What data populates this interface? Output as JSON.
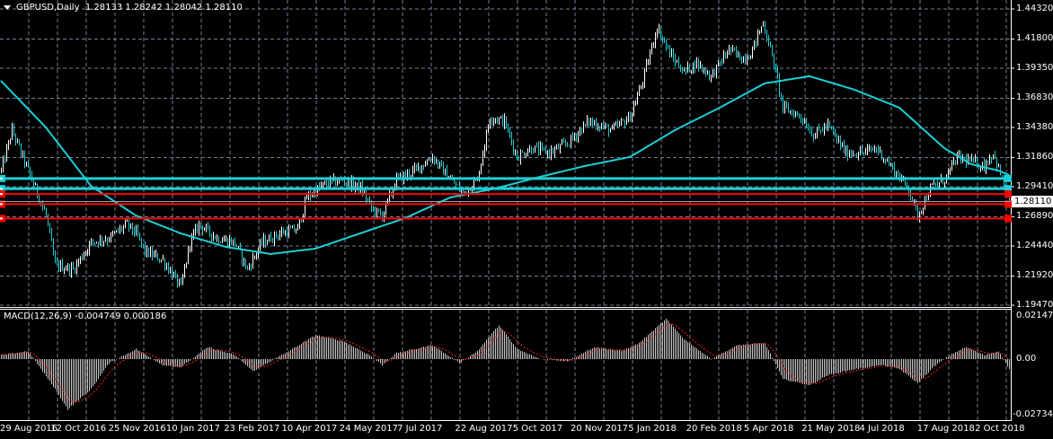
{
  "header": {
    "symbol": "GBPUSD,Daily",
    "ohlc": "1.28133 1.28242 1.28042 1.28110"
  },
  "macd": {
    "label": "MACD(12,26,9) -0.004749 0.000186",
    "axis_labels": [
      "0.021478",
      "0.00",
      "-0.027346"
    ],
    "max": 0.021478,
    "min": -0.027346
  },
  "current_price": "1.28110",
  "colors": {
    "bg": "#000000",
    "grid": "#6f7f95",
    "bar_up": "#ffffff",
    "bar_down": "#1ccfd6",
    "ma": "#1ccfd6",
    "cyan_line": "#1ccfd6",
    "red_line": "#ff0000",
    "signal": "#ff2020",
    "hist": "#c8c8c8"
  },
  "chart_data": {
    "type": "ohlc-bar",
    "symbol": "GBPUSD",
    "timeframe": "Daily",
    "ylim": [
      1.1947,
      1.4432
    ],
    "price_ticks": [
      "1.44320",
      "1.41800",
      "1.39350",
      "1.36830",
      "1.34380",
      "1.31860",
      "1.29410",
      "1.26890",
      "1.24440",
      "1.21920",
      "1.19470"
    ],
    "price_tick_values": [
      1.4432,
      1.418,
      1.3935,
      1.3683,
      1.3438,
      1.3186,
      1.2941,
      1.2689,
      1.2444,
      1.2192,
      1.1947
    ],
    "date_ticks": [
      "29 Aug 2016",
      "12 Oct 2016",
      "25 Nov 2016",
      "10 Jan 2017",
      "23 Feb 2017",
      "10 Apr 2017",
      "24 May 2017",
      "7 Jul 2017",
      "22 Aug 2017",
      "5 Oct 2017",
      "20 Nov 2017",
      "5 Jan 2018",
      "20 Feb 2018",
      "5 Apr 2018",
      "21 May 2018",
      "4 Jul 2018",
      "17 Aug 2018",
      "2 Oct 2018"
    ],
    "bar_count": 562,
    "close_anchors": [
      [
        0,
        1.3077
      ],
      [
        6,
        1.3415
      ],
      [
        15,
        1.3077
      ],
      [
        25,
        1.27
      ],
      [
        30,
        1.2286
      ],
      [
        40,
        1.2248
      ],
      [
        50,
        1.2474
      ],
      [
        60,
        1.2512
      ],
      [
        70,
        1.2625
      ],
      [
        75,
        1.255
      ],
      [
        80,
        1.2399
      ],
      [
        90,
        1.2324
      ],
      [
        100,
        1.2098
      ],
      [
        105,
        1.2474
      ],
      [
        110,
        1.2625
      ],
      [
        120,
        1.2512
      ],
      [
        130,
        1.2474
      ],
      [
        137,
        1.2248
      ],
      [
        145,
        1.2474
      ],
      [
        155,
        1.255
      ],
      [
        165,
        1.2587
      ],
      [
        170,
        1.2851
      ],
      [
        180,
        1.2964
      ],
      [
        190,
        1.3001
      ],
      [
        200,
        1.2926
      ],
      [
        207,
        1.2738
      ],
      [
        212,
        1.27
      ],
      [
        220,
        1.3001
      ],
      [
        230,
        1.3077
      ],
      [
        240,
        1.319
      ],
      [
        250,
        1.3001
      ],
      [
        257,
        1.2888
      ],
      [
        265,
        1.3001
      ],
      [
        272,
        1.3529
      ],
      [
        280,
        1.3491
      ],
      [
        287,
        1.319
      ],
      [
        295,
        1.3265
      ],
      [
        305,
        1.3227
      ],
      [
        315,
        1.3303
      ],
      [
        327,
        1.3491
      ],
      [
        340,
        1.3415
      ],
      [
        350,
        1.3529
      ],
      [
        357,
        1.383
      ],
      [
        365,
        1.4281
      ],
      [
        372,
        1.4056
      ],
      [
        380,
        1.3905
      ],
      [
        387,
        1.398
      ],
      [
        395,
        1.3867
      ],
      [
        405,
        1.4093
      ],
      [
        412,
        1.4018
      ],
      [
        417,
        1.4056
      ],
      [
        424,
        1.4319
      ],
      [
        430,
        1.398
      ],
      [
        435,
        1.3604
      ],
      [
        445,
        1.3529
      ],
      [
        452,
        1.3378
      ],
      [
        460,
        1.3453
      ],
      [
        470,
        1.3227
      ],
      [
        480,
        1.3227
      ],
      [
        487,
        1.3265
      ],
      [
        495,
        1.3115
      ],
      [
        505,
        1.2926
      ],
      [
        510,
        1.27
      ],
      [
        517,
        1.2926
      ],
      [
        525,
        1.3001
      ],
      [
        532,
        1.319
      ],
      [
        540,
        1.3152
      ],
      [
        547,
        1.3115
      ],
      [
        552,
        1.3227
      ],
      [
        561,
        1.2811
      ]
    ],
    "moving_average": [
      [
        0,
        1.383
      ],
      [
        25,
        1.3439
      ],
      [
        50,
        1.295
      ],
      [
        75,
        1.27
      ],
      [
        100,
        1.255
      ],
      [
        125,
        1.2437
      ],
      [
        150,
        1.2377
      ],
      [
        175,
        1.2422
      ],
      [
        200,
        1.255
      ],
      [
        225,
        1.2678
      ],
      [
        250,
        1.2851
      ],
      [
        275,
        1.2926
      ],
      [
        300,
        1.3024
      ],
      [
        325,
        1.3115
      ],
      [
        350,
        1.319
      ],
      [
        375,
        1.3415
      ],
      [
        400,
        1.3604
      ],
      [
        425,
        1.3808
      ],
      [
        450,
        1.3868
      ],
      [
        475,
        1.3755
      ],
      [
        500,
        1.3604
      ],
      [
        525,
        1.3265
      ],
      [
        540,
        1.313
      ],
      [
        555,
        1.3077
      ],
      [
        561,
        1.304
      ]
    ],
    "horizontal_lines": [
      {
        "price": 1.301,
        "color": "cyan"
      },
      {
        "price": 1.2925,
        "color": "cyan"
      },
      {
        "price": 1.288,
        "color": "red"
      },
      {
        "price": 1.2795,
        "color": "red"
      },
      {
        "price": 1.2675,
        "color": "red"
      }
    ],
    "macd_anchors": [
      [
        0,
        0.002
      ],
      [
        15,
        0.004
      ],
      [
        30,
        -0.015
      ],
      [
        37,
        -0.025
      ],
      [
        50,
        -0.015
      ],
      [
        60,
        -0.002
      ],
      [
        75,
        0.005
      ],
      [
        90,
        -0.003
      ],
      [
        100,
        -0.004
      ],
      [
        115,
        0.006
      ],
      [
        130,
        0.002
      ],
      [
        140,
        -0.006
      ],
      [
        150,
        -0.001
      ],
      [
        160,
        0.004
      ],
      [
        175,
        0.012
      ],
      [
        190,
        0.009
      ],
      [
        205,
        0.002
      ],
      [
        212,
        -0.003
      ],
      [
        220,
        0.003
      ],
      [
        240,
        0.007
      ],
      [
        255,
        -0.002
      ],
      [
        265,
        0.004
      ],
      [
        277,
        0.017
      ],
      [
        287,
        0.005
      ],
      [
        300,
        0.0
      ],
      [
        315,
        -0.001
      ],
      [
        330,
        0.006
      ],
      [
        345,
        0.004
      ],
      [
        355,
        0.008
      ],
      [
        370,
        0.02
      ],
      [
        380,
        0.01
      ],
      [
        395,
        0.0
      ],
      [
        410,
        0.007
      ],
      [
        425,
        0.008
      ],
      [
        435,
        -0.01
      ],
      [
        450,
        -0.013
      ],
      [
        460,
        -0.008
      ],
      [
        475,
        -0.005
      ],
      [
        490,
        -0.003
      ],
      [
        500,
        -0.005
      ],
      [
        510,
        -0.012
      ],
      [
        520,
        -0.003
      ],
      [
        530,
        0.003
      ],
      [
        537,
        0.006
      ],
      [
        547,
        0.002
      ],
      [
        555,
        0.004
      ],
      [
        561,
        -0.005
      ]
    ]
  }
}
